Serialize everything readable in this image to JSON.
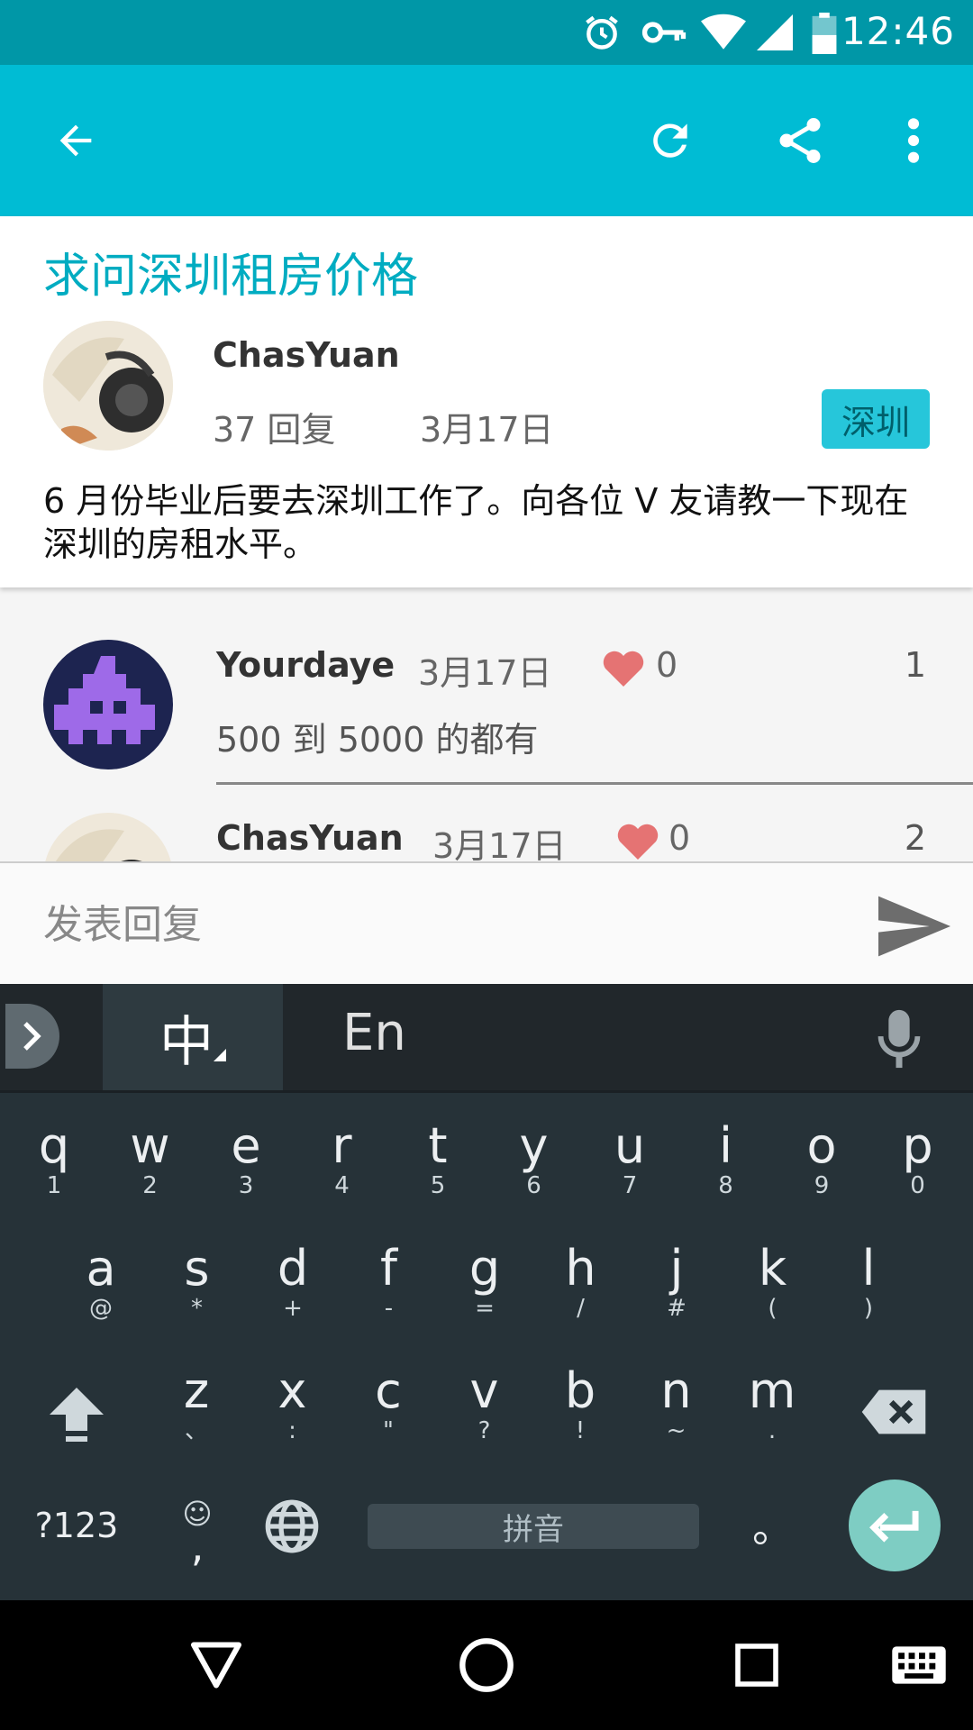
{
  "status_bar": {
    "time": "12:46",
    "icons": [
      "alarm-icon",
      "vpn-key-icon",
      "wifi-icon",
      "signal-icon",
      "battery-icon"
    ]
  },
  "app_bar": {
    "icons": [
      "back-arrow-icon",
      "refresh-icon",
      "share-icon",
      "more-vert-icon"
    ],
    "color": "#00bcd4"
  },
  "post": {
    "title": "求问深圳租房价格",
    "author": "ChasYuan",
    "reply_count": "37 回复",
    "date": "3月17日",
    "tag": "深圳",
    "body": "6 月份毕业后要去深圳工作了。向各位 V 友请教一下现在深圳的房租水平。"
  },
  "replies": [
    {
      "author": "Yourdaye",
      "date": "3月17日",
      "likes": "0",
      "floor": "1",
      "text": "500 到 5000 的都有"
    },
    {
      "author": "ChasYuan",
      "date": "3月17日",
      "likes": "0",
      "floor": "2",
      "text": ""
    }
  ],
  "compose": {
    "placeholder": "发表回复",
    "value": ""
  },
  "keyboard": {
    "lang_zh": "中",
    "lang_en": "En",
    "row1": [
      {
        "k": "q",
        "s": "1"
      },
      {
        "k": "w",
        "s": "2"
      },
      {
        "k": "e",
        "s": "3"
      },
      {
        "k": "r",
        "s": "4"
      },
      {
        "k": "t",
        "s": "5"
      },
      {
        "k": "y",
        "s": "6"
      },
      {
        "k": "u",
        "s": "7"
      },
      {
        "k": "i",
        "s": "8"
      },
      {
        "k": "o",
        "s": "9"
      },
      {
        "k": "p",
        "s": "0"
      }
    ],
    "row2": [
      {
        "k": "a",
        "s": "@"
      },
      {
        "k": "s",
        "s": "*"
      },
      {
        "k": "d",
        "s": "+"
      },
      {
        "k": "f",
        "s": "-"
      },
      {
        "k": "g",
        "s": "="
      },
      {
        "k": "h",
        "s": "/"
      },
      {
        "k": "j",
        "s": "#"
      },
      {
        "k": "k",
        "s": "("
      },
      {
        "k": "l",
        "s": ")"
      }
    ],
    "row3": [
      {
        "k": "z",
        "s": "、"
      },
      {
        "k": "x",
        "s": ":"
      },
      {
        "k": "c",
        "s": "\""
      },
      {
        "k": "v",
        "s": "?"
      },
      {
        "k": "b",
        "s": "!"
      },
      {
        "k": "n",
        "s": "~"
      },
      {
        "k": "m",
        "s": "."
      }
    ],
    "symbols_key": "?123",
    "emoji_key": "☺",
    "comma": ",",
    "space_label": "拼音",
    "period": "。"
  },
  "nav_bar": {
    "icons": [
      "back-triangle-icon",
      "home-circle-icon",
      "recents-square-icon",
      "keyboard-icon"
    ]
  }
}
